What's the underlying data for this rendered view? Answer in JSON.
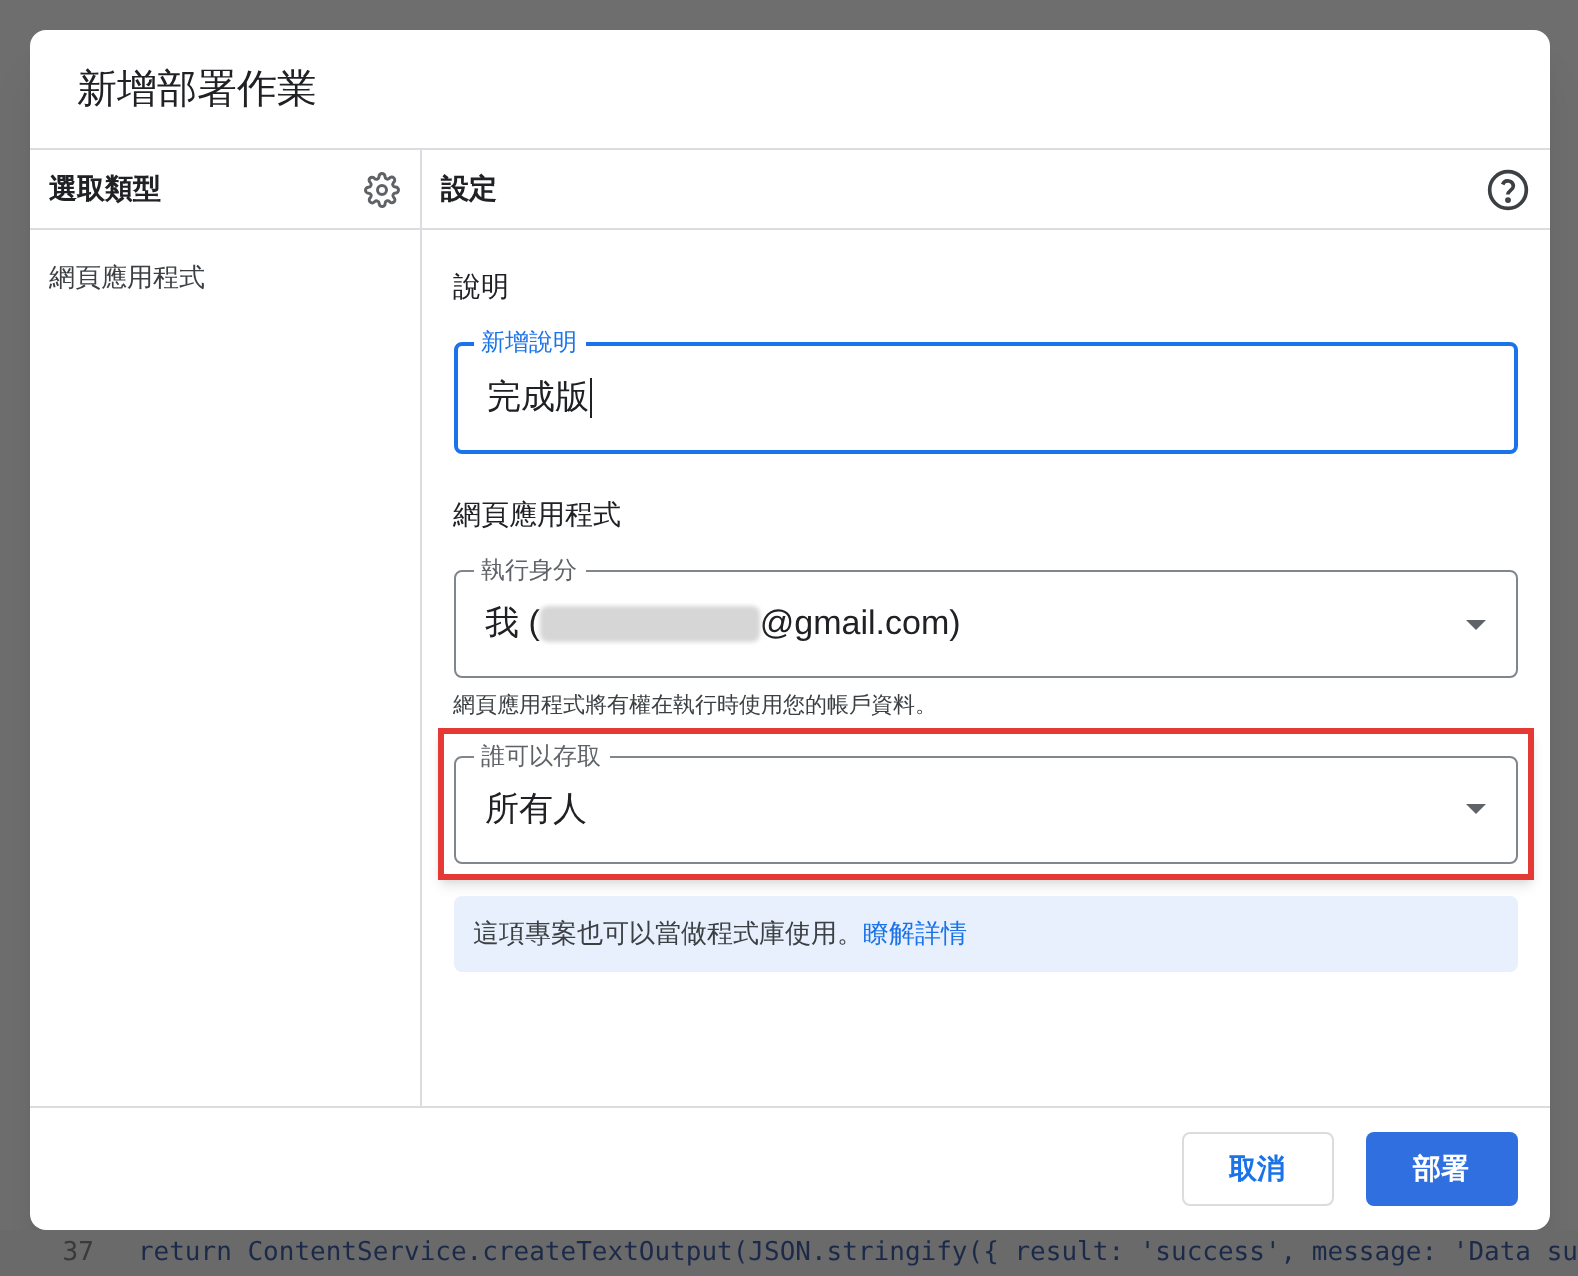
{
  "background_editor": {
    "line_number": "37",
    "code": "return ContentService.createTextOutput(JSON.stringify({ result: 'success', message: 'Data su"
  },
  "dialog": {
    "title": "新增部署作業",
    "sidebar": {
      "heading": "選取類型",
      "items": [
        {
          "label": "網頁應用程式",
          "selected": false
        }
      ]
    },
    "settings": {
      "heading": "設定",
      "description_section": {
        "heading": "說明",
        "field": {
          "label": "新增說明",
          "value": "完成版",
          "focused": true
        }
      },
      "webapp_section": {
        "heading": "網頁應用程式",
        "execute_as": {
          "label": "執行身分",
          "value_prefix": "我 (",
          "value_suffix": "@gmail.com)",
          "redacted": true,
          "highlighted": false
        },
        "hint": "網頁應用程式將有權在執行時使用您的帳戶資料。",
        "access": {
          "label": "誰可以存取",
          "value": "所有人",
          "highlighted": true
        }
      },
      "info": {
        "text": "這項專案也可以當做程式庫使用。",
        "link": "瞭解詳情"
      }
    },
    "buttons": [
      {
        "label": "取消",
        "kind": "secondary"
      },
      {
        "label": "部署",
        "kind": "primary"
      }
    ]
  }
}
